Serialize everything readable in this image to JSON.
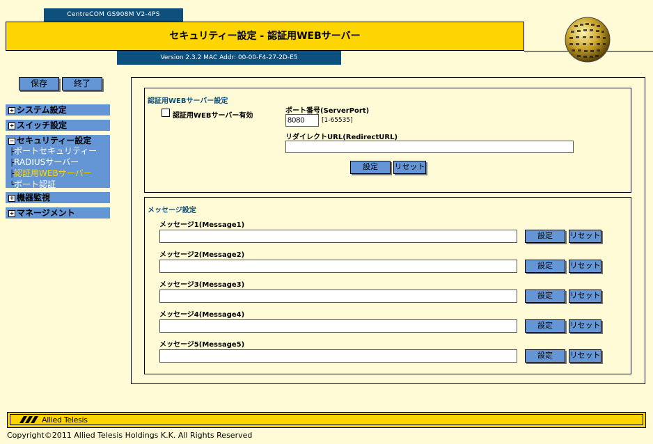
{
  "header": {
    "model": "CentreCOM GS908M V2-4PS",
    "title": "セキュリティー設定 - 認証用WEBサーバー",
    "version": "Version 2.3.2 MAC Addr: 00-00-F4-27-2D-E5"
  },
  "actions": {
    "save": "保存",
    "exit": "終了"
  },
  "sidebar": {
    "items": [
      {
        "label": "システム設定",
        "toggle": "+"
      },
      {
        "label": "スイッチ設定",
        "toggle": "+"
      },
      {
        "label": "セキュリティー設定",
        "toggle": "−",
        "children": [
          "ポートセキュリティー",
          "RADIUSサーバー",
          "認証用WEBサーバー",
          "ポート認証"
        ]
      },
      {
        "label": "機器監視",
        "toggle": "+"
      },
      {
        "label": "マネージメント",
        "toggle": "+"
      }
    ]
  },
  "web_server": {
    "section_title": "認証用WEBサーバー設定",
    "enable_label": "認証用WEBサーバー有効",
    "enabled": false,
    "port_label": "ポート番号(ServerPort)",
    "port_value": "8080",
    "port_range": "[1-65535]",
    "redirect_label": "リダイレクトURL(RedirectURL)",
    "redirect_value": "",
    "set_label": "設定",
    "reset_label": "リセット"
  },
  "messages": {
    "section_title": "メッセージ設定",
    "items": [
      {
        "label": "メッセージ1(Message1)",
        "value": ""
      },
      {
        "label": "メッセージ2(Message2)",
        "value": ""
      },
      {
        "label": "メッセージ3(Message3)",
        "value": ""
      },
      {
        "label": "メッセージ4(Message4)",
        "value": ""
      },
      {
        "label": "メッセージ5(Message5)",
        "value": ""
      }
    ],
    "set_label": "設定",
    "reset_label": "リセット"
  },
  "footer": {
    "logo": "Allied Telesis",
    "copyright": "Copyright©2011 Allied Telesis Holdings K.K. All Rights Reserved"
  },
  "colors": {
    "gold": "#fcd502",
    "navy": "#0d4f7d",
    "nav_blue": "#6495d4",
    "page_bg": "#fffbd6"
  }
}
